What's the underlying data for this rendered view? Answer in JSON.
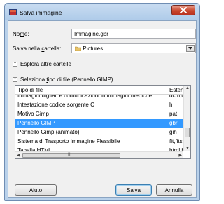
{
  "window": {
    "title": "Salva immagine"
  },
  "form": {
    "name_label_pre": "No",
    "name_label_u": "m",
    "name_label_post": "e:",
    "name_value": "Immagine.gbr",
    "folder_label_pre": "Salva nella ",
    "folder_label_u": "c",
    "folder_label_post": "artella:",
    "folder_value": "Pictures",
    "browse_pre": "",
    "browse_u": "E",
    "browse_post": "splora altre cartelle",
    "filetype_pre": "Seleziona ",
    "filetype_u": "t",
    "filetype_post": "ipo di file (Pennello GIMP)"
  },
  "list": {
    "col_type": "Tipo di file",
    "col_ext": "Estensioni",
    "rows": [
      {
        "type": "Immagini digitali e comunicazioni in immagini mediche",
        "ext": "dcm,dicom"
      },
      {
        "type": "Intestazione codice sorgente C",
        "ext": "h"
      },
      {
        "type": "Motivo Gimp",
        "ext": "pat"
      },
      {
        "type": "Pennello GIMP",
        "ext": "gbr"
      },
      {
        "type": "Pennello Gimp (animato)",
        "ext": "gih"
      },
      {
        "type": "Sistema di Trasporto Immagine Flessibile",
        "ext": "fit,fits"
      },
      {
        "type": "Tabella HTML",
        "ext": "html,htm"
      }
    ],
    "selected_index": 3,
    "hscroll_grip": "III"
  },
  "buttons": {
    "help": "Aiuto",
    "save_u": "S",
    "save_rest": "alva",
    "cancel_pre": "A",
    "cancel_u": "n",
    "cancel_post": "nulla"
  },
  "colors": {
    "selection": "#3399ff",
    "close": "#c8452b"
  },
  "icons": {
    "app": "gimp-app-icon",
    "folder": "folder-icon",
    "close": "close-icon"
  }
}
